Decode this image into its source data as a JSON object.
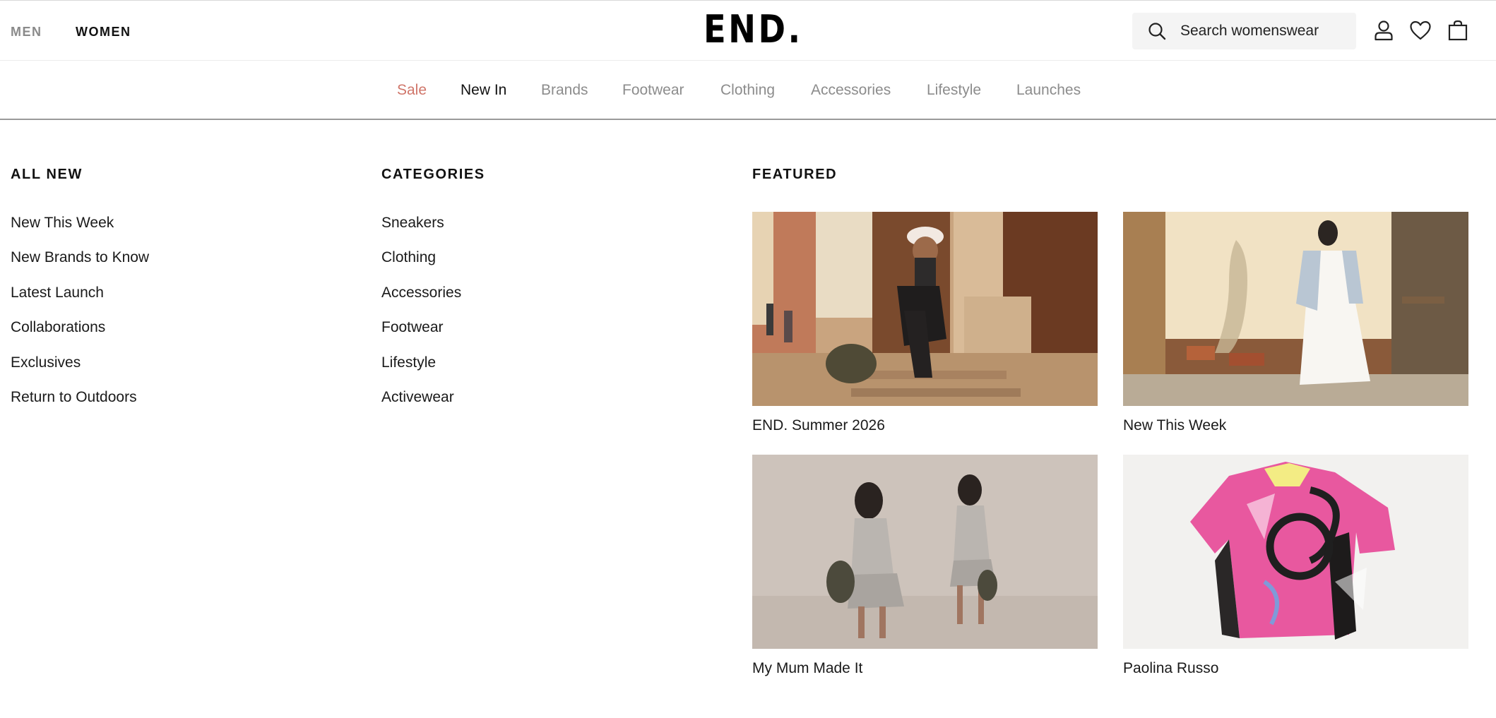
{
  "header": {
    "gender_tabs": {
      "men": "MEN",
      "women": "WOMEN"
    },
    "logo": "END.",
    "search": {
      "placeholder": "Search womenswear",
      "value": ""
    },
    "icons": [
      "search-icon",
      "account-icon",
      "wishlist-heart-icon",
      "shopping-bag-icon"
    ]
  },
  "nav": {
    "items": [
      "Sale",
      "New In",
      "Brands",
      "Footwear",
      "Clothing",
      "Accessories",
      "Lifestyle",
      "Launches"
    ],
    "active": "New In",
    "sale_color": "#d0766a"
  },
  "menu": {
    "all_new": {
      "heading": "ALL NEW",
      "links": [
        "New This Week",
        "New Brands to Know",
        "Latest Launch",
        "Collaborations",
        "Exclusives",
        "Return to Outdoors"
      ]
    },
    "categories": {
      "heading": "CATEGORIES",
      "links": [
        "Sneakers",
        "Clothing",
        "Accessories",
        "Footwear",
        "Lifestyle",
        "Activewear"
      ]
    },
    "featured": {
      "heading": "FEATURED",
      "cards": [
        {
          "caption": "END. Summer 2026"
        },
        {
          "caption": "New This Week"
        },
        {
          "caption": "My Mum Made It"
        },
        {
          "caption": "Paolina Russo"
        }
      ]
    }
  }
}
